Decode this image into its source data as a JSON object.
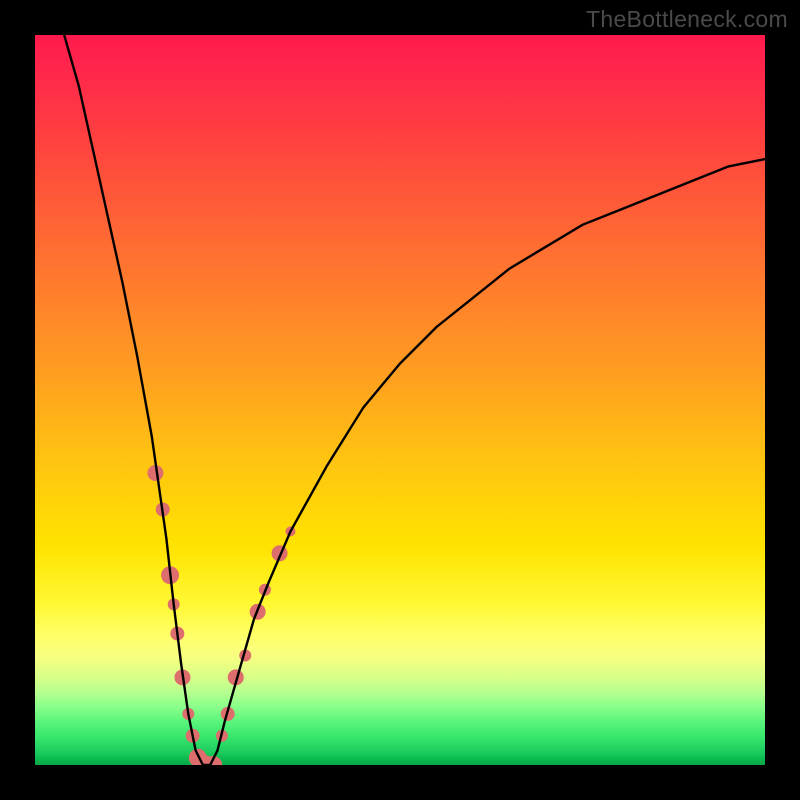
{
  "watermark": {
    "text": "TheBottleneck.com"
  },
  "chart_data": {
    "type": "line",
    "title": "",
    "xlabel": "",
    "ylabel": "",
    "xlim": [
      0,
      100
    ],
    "ylim": [
      0,
      100
    ],
    "grid": false,
    "series": [
      {
        "name": "bottleneck-curve",
        "stroke": "#000000",
        "x": [
          4,
          6,
          8,
          10,
          12,
          14,
          16,
          18,
          19,
          20,
          21,
          22,
          23,
          24,
          25,
          26,
          28,
          30,
          32,
          35,
          40,
          45,
          50,
          55,
          60,
          65,
          70,
          75,
          80,
          85,
          90,
          95,
          100
        ],
        "y": [
          100,
          93,
          84,
          75,
          66,
          56,
          45,
          31,
          22,
          14,
          7,
          2,
          0,
          0,
          2,
          6,
          13,
          20,
          25,
          32,
          41,
          49,
          55,
          60,
          64,
          68,
          71,
          74,
          76,
          78,
          80,
          82,
          83
        ]
      }
    ],
    "markers": {
      "name": "highlight-points",
      "color": "#de6d6d",
      "radius_range": [
        5,
        10
      ],
      "points": [
        {
          "x": 16.5,
          "y": 40,
          "r": 8
        },
        {
          "x": 17.5,
          "y": 35,
          "r": 7
        },
        {
          "x": 18.5,
          "y": 26,
          "r": 9
        },
        {
          "x": 19.0,
          "y": 22,
          "r": 6
        },
        {
          "x": 19.5,
          "y": 18,
          "r": 7
        },
        {
          "x": 20.2,
          "y": 12,
          "r": 8
        },
        {
          "x": 21.0,
          "y": 7,
          "r": 6
        },
        {
          "x": 21.6,
          "y": 4,
          "r": 7
        },
        {
          "x": 22.3,
          "y": 1,
          "r": 9
        },
        {
          "x": 23.2,
          "y": 0,
          "r": 10
        },
        {
          "x": 24.4,
          "y": 0,
          "r": 9
        },
        {
          "x": 25.6,
          "y": 4,
          "r": 6
        },
        {
          "x": 26.4,
          "y": 7,
          "r": 7
        },
        {
          "x": 27.5,
          "y": 12,
          "r": 8
        },
        {
          "x": 28.8,
          "y": 15,
          "r": 6
        },
        {
          "x": 30.5,
          "y": 21,
          "r": 8
        },
        {
          "x": 31.5,
          "y": 24,
          "r": 6
        },
        {
          "x": 33.5,
          "y": 29,
          "r": 8
        },
        {
          "x": 35.0,
          "y": 32,
          "r": 5
        }
      ]
    }
  }
}
